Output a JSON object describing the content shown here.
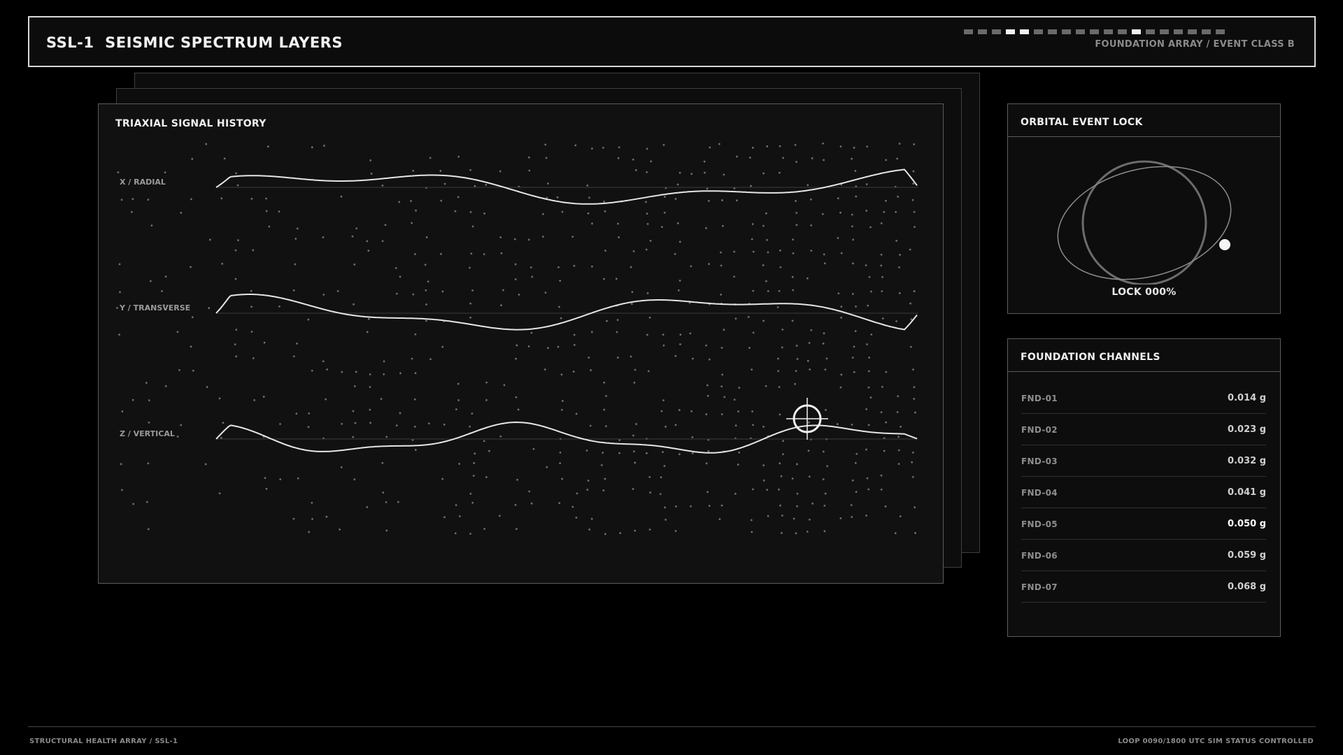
{
  "header": {
    "title": "SSL-1  SEISMIC SPECTRUM LAYERS",
    "subtitle": "FOUNDATION ARRAY / EVENT CLASS B",
    "segments": [
      0,
      0,
      0,
      1,
      1,
      0,
      0,
      0,
      0,
      0,
      0,
      0,
      1,
      0,
      0,
      0,
      0,
      0,
      0
    ]
  },
  "signal_panel": {
    "title": "TRIAXIAL SIGNAL HISTORY",
    "axes": [
      {
        "label": "X / RADIAL"
      },
      {
        "label": "Y / TRANSVERSE"
      },
      {
        "label": "Z / VERTICAL"
      }
    ]
  },
  "orbital": {
    "title": "ORBITAL EVENT LOCK",
    "lock_text": "LOCK 000%"
  },
  "channels": {
    "title": "FOUNDATION CHANNELS",
    "items": [
      {
        "name": "FND-01",
        "value": "0.014 g"
      },
      {
        "name": "FND-02",
        "value": "0.023 g"
      },
      {
        "name": "FND-03",
        "value": "0.032 g"
      },
      {
        "name": "FND-04",
        "value": "0.041 g"
      },
      {
        "name": "FND-05",
        "value": "0.050 g",
        "highlight": true
      },
      {
        "name": "FND-06",
        "value": "0.059 g"
      },
      {
        "name": "FND-07",
        "value": "0.068 g"
      }
    ]
  },
  "footer": {
    "left": "STRUCTURAL HEALTH ARRAY / SSL-1",
    "right": "LOOP 0090/1800  UTC SIM  STATUS CONTROLLED"
  },
  "colors": {
    "background": "#000000",
    "panel": "#101110",
    "trace": "#e6e6e6",
    "dot": "#6e6e6e"
  }
}
